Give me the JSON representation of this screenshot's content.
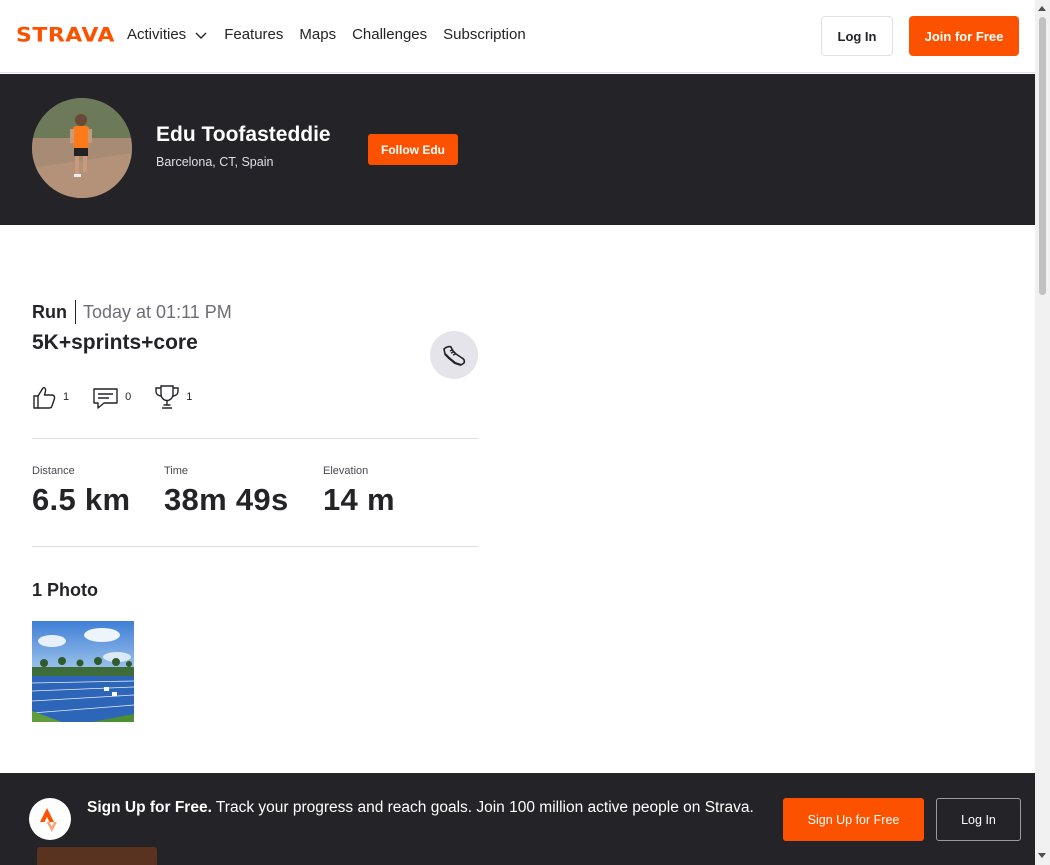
{
  "brand": {
    "logo_text": "STRAVA",
    "accent_color": "#fc5200",
    "dark_color": "#242428"
  },
  "nav": {
    "items": [
      {
        "label": "Activities",
        "has_dropdown": true
      },
      {
        "label": "Features"
      },
      {
        "label": "Maps"
      },
      {
        "label": "Challenges"
      },
      {
        "label": "Subscription"
      }
    ],
    "login_label": "Log In",
    "join_label": "Join for Free"
  },
  "profile": {
    "name": "Edu Toofasteddie",
    "location": "Barcelona, CT, Spain",
    "follow_label": "Follow Edu"
  },
  "activity": {
    "type": "Run",
    "time": "Today at 01:11 PM",
    "title": "5K+sprints+core",
    "sport_icon": "running-shoe-icon",
    "kudos_count": "1",
    "comments_count": "0",
    "achievements_count": "1",
    "stats": [
      {
        "label": "Distance",
        "value": "6.5 km"
      },
      {
        "label": "Time",
        "value": "38m 49s"
      },
      {
        "label": "Elevation",
        "value": "14 m"
      }
    ],
    "photos_heading": "1 Photo"
  },
  "cta": {
    "bold": "Sign Up for Free.",
    "text": "Track your progress and reach goals. Join 100 million active people on Strava.",
    "signup_label": "Sign Up for Free",
    "login_label": "Log In"
  }
}
